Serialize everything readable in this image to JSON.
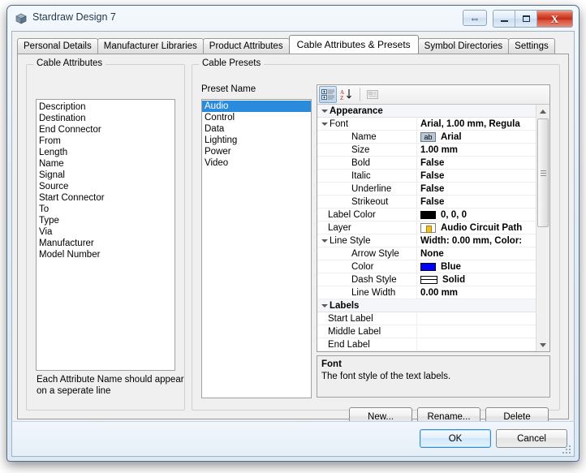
{
  "window": {
    "title": "Stardraw Design 7",
    "icon": "app-cube-icon",
    "buttons": {
      "resize": "⇔",
      "minimize": "minimize-icon",
      "maximize": "maximize-icon",
      "close": "X"
    }
  },
  "tabs": [
    {
      "label": "Personal Details",
      "active": false
    },
    {
      "label": "Manufacturer Libraries",
      "active": false
    },
    {
      "label": "Product Attributes",
      "active": false
    },
    {
      "label": "Cable Attributes & Presets",
      "active": true
    },
    {
      "label": "Symbol Directories",
      "active": false
    },
    {
      "label": "Settings",
      "active": false
    }
  ],
  "cable_attributes": {
    "group_title": "Cable Attributes",
    "items": [
      "Description",
      "Destination",
      "End Connector",
      "From",
      "Length",
      "Name",
      "Signal",
      "Source",
      "Start Connector",
      "To",
      "Type",
      "Via",
      "Manufacturer",
      "Model Number"
    ],
    "hint_line1": "Each Attribute Name should appear",
    "hint_line2": "on a seperate line"
  },
  "cable_presets": {
    "group_title": "Cable Presets",
    "list_label": "Preset Name",
    "items": [
      {
        "label": "Audio",
        "selected": true
      },
      {
        "label": "Control",
        "selected": false
      },
      {
        "label": "Data",
        "selected": false
      },
      {
        "label": "Lighting",
        "selected": false
      },
      {
        "label": "Power",
        "selected": false
      },
      {
        "label": "Video",
        "selected": false
      }
    ],
    "buttons": {
      "new": "New...",
      "rename": "Rename...",
      "delete": "Delete"
    }
  },
  "property_grid": {
    "toolbar": [
      {
        "name": "categorized-view-icon",
        "pressed": true,
        "disabled": false
      },
      {
        "name": "alphabetical-sort-icon",
        "pressed": false,
        "disabled": false
      },
      {
        "name": "property-pages-icon",
        "pressed": false,
        "disabled": true
      }
    ],
    "rows": [
      {
        "type": "category",
        "indent": 0,
        "expander": true,
        "name": "Appearance",
        "value": ""
      },
      {
        "type": "group",
        "indent": 1,
        "expander": true,
        "name": "Font",
        "value": "Arial, 1.00 mm, Regula"
      },
      {
        "type": "prop",
        "indent": 2,
        "expander": false,
        "name": "Name",
        "value": "Arial",
        "icon": "ab"
      },
      {
        "type": "prop",
        "indent": 2,
        "expander": false,
        "name": "Size",
        "value": "1.00 mm"
      },
      {
        "type": "prop",
        "indent": 2,
        "expander": false,
        "name": "Bold",
        "value": "False"
      },
      {
        "type": "prop",
        "indent": 2,
        "expander": false,
        "name": "Italic",
        "value": "False"
      },
      {
        "type": "prop",
        "indent": 2,
        "expander": false,
        "name": "Underline",
        "value": "False"
      },
      {
        "type": "prop",
        "indent": 2,
        "expander": false,
        "name": "Strikeout",
        "value": "False"
      },
      {
        "type": "prop",
        "indent": 1,
        "expander": false,
        "name": "Label Color",
        "value": "0, 0, 0",
        "icon": "swatch",
        "swatch_color": "#000000"
      },
      {
        "type": "prop",
        "indent": 1,
        "expander": false,
        "name": "Layer",
        "value": "Audio Circuit Path",
        "icon": "layer"
      },
      {
        "type": "group",
        "indent": 1,
        "expander": true,
        "name": "Line Style",
        "value": "Width: 0.00 mm, Color:"
      },
      {
        "type": "prop",
        "indent": 2,
        "expander": false,
        "name": "Arrow Style",
        "value": "None"
      },
      {
        "type": "prop",
        "indent": 2,
        "expander": false,
        "name": "Color",
        "value": "Blue",
        "icon": "swatch",
        "swatch_color": "#0000ff"
      },
      {
        "type": "prop",
        "indent": 2,
        "expander": false,
        "name": "Dash Style",
        "value": "Solid",
        "icon": "dash"
      },
      {
        "type": "prop",
        "indent": 2,
        "expander": false,
        "name": "Line Width",
        "value": "0.00 mm"
      },
      {
        "type": "category",
        "indent": 0,
        "expander": true,
        "name": "Labels",
        "value": ""
      },
      {
        "type": "prop",
        "indent": 1,
        "expander": false,
        "name": "Start Label",
        "value": ""
      },
      {
        "type": "prop",
        "indent": 1,
        "expander": false,
        "name": "Middle Label",
        "value": ""
      },
      {
        "type": "prop",
        "indent": 1,
        "expander": false,
        "name": "End Label",
        "value": ""
      }
    ]
  },
  "description": {
    "title": "Font",
    "text": "The font style of the text labels."
  },
  "dialog_buttons": {
    "ok": "OK",
    "cancel": "Cancel"
  },
  "colors": {
    "selection_blue": "#2a8bdd",
    "line_color_blue": "#0000ff",
    "label_color_black": "#000000",
    "close_button_red": "#c22c18"
  }
}
